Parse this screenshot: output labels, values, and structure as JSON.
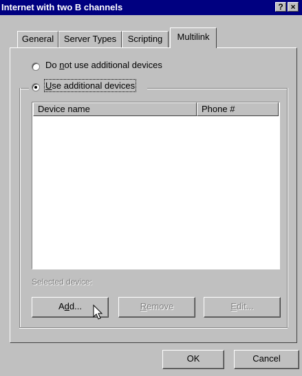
{
  "window": {
    "title": "Internet with two B channels",
    "help_glyph": "?",
    "close_glyph": "×"
  },
  "tabs": [
    {
      "label": "General"
    },
    {
      "label": "Server Types"
    },
    {
      "label": "Scripting"
    },
    {
      "label": "Multilink"
    }
  ],
  "multilink": {
    "option_no_pre": "Do ",
    "option_no_ul": "n",
    "option_no_post": "ot use additional devices",
    "option_use_ul": "U",
    "option_use_post": "se additional devices",
    "columns": {
      "device_name": "Device name",
      "phone": "Phone #"
    },
    "selected_device_label": "Selected device:",
    "add_pre": "A",
    "add_ul": "d",
    "add_post": "d...",
    "remove_ul": "R",
    "remove_post": "emove",
    "edit_ul": "E",
    "edit_post": "dit..."
  },
  "footer": {
    "ok_label": "OK",
    "cancel_label": "Cancel"
  }
}
